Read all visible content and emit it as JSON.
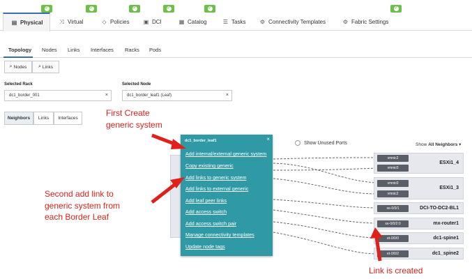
{
  "top_tabs": [
    {
      "label": "Physical",
      "icon": "server-icon",
      "active": true
    },
    {
      "label": "Virtual",
      "icon": "shuffle-icon"
    },
    {
      "label": "Policies",
      "icon": "shield-icon"
    },
    {
      "label": "DCI",
      "icon": "camera-icon"
    },
    {
      "label": "Catalog",
      "icon": "calendar-icon"
    },
    {
      "label": "Tasks",
      "icon": "list-icon"
    },
    {
      "label": "Connectivity Templates",
      "icon": "network-icon"
    },
    {
      "label": "Fabric Settings",
      "icon": "settings-icon"
    }
  ],
  "badge_color": "#6cc04a",
  "sub_tabs": [
    "Topology",
    "Nodes",
    "Links",
    "Interfaces",
    "Racks",
    "Pods"
  ],
  "view_buttons": [
    "Nodes",
    "Links"
  ],
  "selected_rack": {
    "label": "Selected Rack",
    "value": "dc1_border_001"
  },
  "selected_node": {
    "label": "Selected Node",
    "value": "dc1_border_leaf1 (Leaf)"
  },
  "segments": [
    "Neighbors",
    "Links",
    "Interfaces"
  ],
  "show_unused_ports": "Show Unused Ports",
  "show_neighbors": {
    "prefix": "Show",
    "value": "All Neighbors"
  },
  "neighbors": [
    {
      "name": "ESXi1_4",
      "ports": [
        "vmnic2",
        "vmnic0"
      ]
    },
    {
      "name": "ESXi1_3",
      "ports": [
        "vmnic0",
        "vmnic2"
      ]
    },
    {
      "name": "DCI-TO-DC2-BL1",
      "ports": [
        "xe-0/0/1"
      ]
    },
    {
      "name": "mx-router1",
      "ports": [
        "xe-0/0/2:0"
      ]
    },
    {
      "name": "dc1-spine1",
      "ports": [
        "et-0/0/0"
      ]
    },
    {
      "name": "dc1_spine2",
      "ports": [
        "et-0/0/2"
      ]
    }
  ],
  "context_menu": {
    "title": "dc1_border_leaf1",
    "close": "×",
    "items": [
      "Add internal/external generic system",
      "Copy existing generic",
      "Add links to generic system",
      "Add links to external generic",
      "Add leaf peer links",
      "Add access switch",
      "Add access switch pair",
      "Manage connectivity templates",
      "Update node tags"
    ],
    "bg_color": "#2f99a5"
  },
  "annotations": {
    "first": [
      "First Create",
      "generic system"
    ],
    "second": [
      "Second add link to",
      "generic system from",
      "each Border Leaf"
    ],
    "third": "Link is created",
    "color": "#e0211b"
  }
}
